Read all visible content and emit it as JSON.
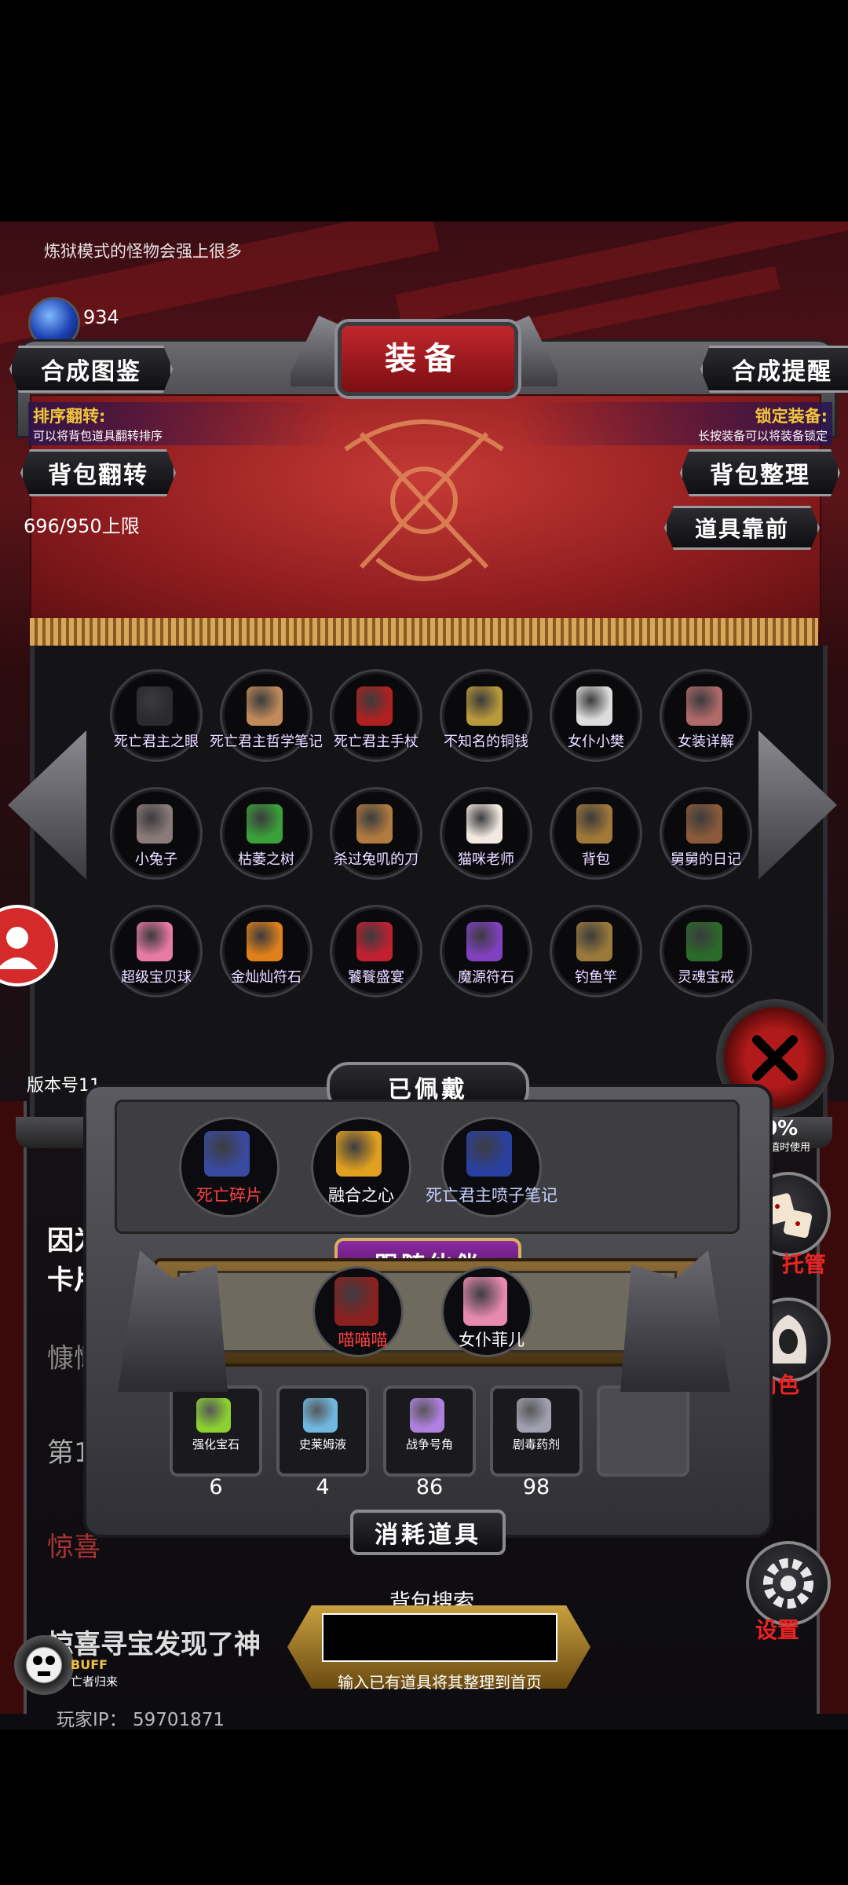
{
  "tip_text": "炼狱模式的怪物会强上很多",
  "currency": {
    "icon": "blue-gem-icon",
    "count": "934"
  },
  "panel": {
    "title": "装备",
    "synth_atlas_label": "合成图鉴",
    "synth_remind_label": "合成提醒",
    "sort_flip": {
      "title": "排序翻转:",
      "desc": "可以将背包道具翻转排序"
    },
    "lock_equip": {
      "title": "锁定装备:",
      "desc": "长按装备可以将装备锁定"
    },
    "bag_flip_label": "背包翻转",
    "bag_sort_label": "背包整理",
    "items_front_label": "道具靠前",
    "capacity": "696/950上限"
  },
  "items": [
    {
      "label": "死亡君主之眼",
      "color": "#2a2a30"
    },
    {
      "label": "死亡君主哲学笔记",
      "color": "#c08a5a"
    },
    {
      "label": "死亡君主手杖",
      "color": "#b02020"
    },
    {
      "label": "不知名的铜钱",
      "color": "#b89a3a"
    },
    {
      "label": "女仆小樊",
      "color": "#ddd"
    },
    {
      "label": "女装详解",
      "color": "#b06a6a"
    },
    {
      "label": "小兔子",
      "color": "#8a7a7a"
    },
    {
      "label": "枯萎之树",
      "color": "#3aa03a"
    },
    {
      "label": "杀过兔叽的刀",
      "color": "#b07a40"
    },
    {
      "label": "猫咪老师",
      "color": "#f2e8e0"
    },
    {
      "label": "背包",
      "color": "#a07838"
    },
    {
      "label": "舅舅的日记",
      "color": "#8a5a3a"
    },
    {
      "label": "超级宝贝球",
      "color": "#e67aa0"
    },
    {
      "label": "金灿灿符石",
      "color": "#e0801a"
    },
    {
      "label": "饕餮盛宴",
      "color": "#c02030"
    },
    {
      "label": "魔源符石",
      "color": "#8040c0"
    },
    {
      "label": "钓鱼竿",
      "color": "#9a7a3a"
    },
    {
      "label": "灵魂宝戒",
      "color": "#2a6a2a"
    }
  ],
  "version_label": "版本号11",
  "equipped": {
    "title": "已佩戴",
    "items": [
      {
        "label": "死亡碎片",
        "color": "#3a4aa0",
        "label_color": "#ff4040"
      },
      {
        "label": "融合之心",
        "color": "#e0a020",
        "label_color": "#ffffff"
      },
      {
        "label": "死亡君主喷子笔记",
        "color": "#2a40a0",
        "label_color": "#c8d0ff"
      }
    ]
  },
  "companions": {
    "title": "跟随伙伴",
    "items": [
      {
        "label": "喵喵喵",
        "color": "#8a2020",
        "label_color": "#ff4040"
      },
      {
        "label": "女仆菲儿",
        "color": "#e88ab0",
        "label_color": "#ffffff"
      }
    ]
  },
  "consumables": {
    "title": "消耗道具",
    "slots": [
      {
        "label": "强化宝石",
        "count": "6",
        "color": "#8ad030"
      },
      {
        "label": "史莱姆液",
        "count": "4",
        "color": "#70b8e0"
      },
      {
        "label": "战争号角",
        "count": "86",
        "color": "#b080e0"
      },
      {
        "label": "剧毒药剂",
        "count": "98",
        "color": "#a0a0b0"
      },
      {
        "label": "",
        "count": "",
        "color": "#333"
      }
    ]
  },
  "bag_search": {
    "title": "背包搜索",
    "placeholder": "",
    "hint": "输入已有道具将其整理到首页"
  },
  "side": {
    "count_value": "30%",
    "count_desc": "其数值时使用",
    "managed_label": "托管",
    "role_label": "角色",
    "settings_label": "设置"
  },
  "background_text": {
    "l1": "因为",
    "l2": "卡片",
    "l3": "慷慨",
    "l4": "第12",
    "l5": "惊喜",
    "news": "惊喜寻宝发现了神"
  },
  "buff": {
    "label": "BUFF",
    "sub": "亡者归来"
  },
  "player_ip": "玩家IP： 59701871"
}
